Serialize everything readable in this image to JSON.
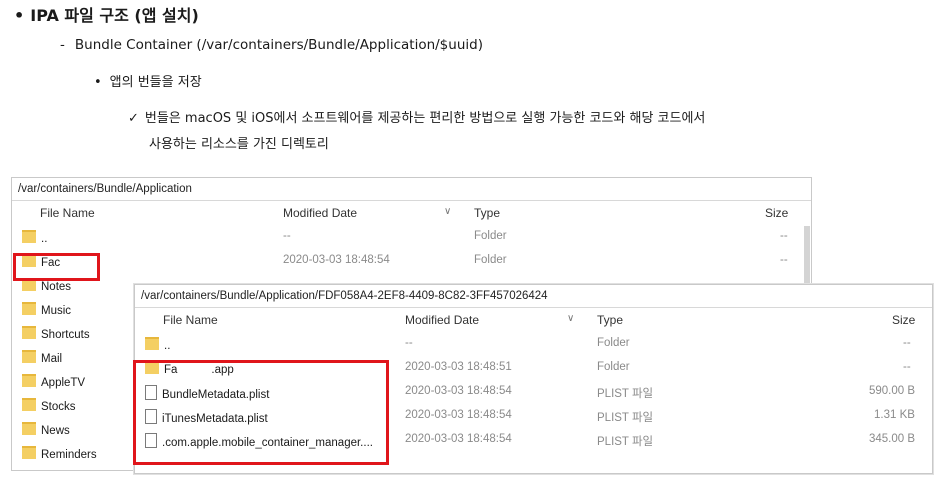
{
  "slide": {
    "heading_bullet": "•",
    "heading": "IPA 파일 구조 (앱 설치)",
    "sub_dash": "-",
    "sub": "Bundle Container (/var/containers/Bundle/Application/$uuid)",
    "item_bullet": "•",
    "item": "앱의 번들을 저장",
    "check": "✓",
    "detail_line1": "번들은 macOS 및 iOS에서 소프트웨어를 제공하는 편리한 방법으로 실행 가능한 코드와 해당 코드에서",
    "detail_line2": "사용하는 리소스를 가진 디렉토리"
  },
  "window1": {
    "path": "/var/containers/Bundle/Application",
    "headers": {
      "name": "File Name",
      "date": "Modified Date",
      "type": "Type",
      "size": "Size"
    },
    "rows": [
      {
        "name": "..",
        "date": "--",
        "type": "Folder",
        "size": "--"
      },
      {
        "name": "Fac",
        "date": "2020-03-03 18:48:54",
        "type": "Folder",
        "size": "--"
      },
      {
        "name": "Notes"
      },
      {
        "name": "Music"
      },
      {
        "name": "Shortcuts"
      },
      {
        "name": "Mail"
      },
      {
        "name": "AppleTV"
      },
      {
        "name": "Stocks"
      },
      {
        "name": "News"
      },
      {
        "name": "Reminders"
      }
    ]
  },
  "window2": {
    "path": "/var/containers/Bundle/Application/FDF058A4-2EF8-4409-8C82-3FF457026424",
    "headers": {
      "name": "File Name",
      "date": "Modified Date",
      "type": "Type",
      "size": "Size"
    },
    "rows": [
      {
        "name": "..",
        "date": "--",
        "type": "Folder",
        "size": "--"
      },
      {
        "name": "Fa",
        "name2": ".app",
        "date": "2020-03-03 18:48:51",
        "type": "Folder",
        "size": "--"
      },
      {
        "name": "BundleMetadata.plist",
        "date": "2020-03-03 18:48:54",
        "type": "PLIST 파일",
        "size": "590.00 B"
      },
      {
        "name": "iTunesMetadata.plist",
        "date": "2020-03-03 18:48:54",
        "type": "PLIST 파일",
        "size": "1.31 KB"
      },
      {
        "name": ".com.apple.mobile_container_manager....",
        "date": "2020-03-03 18:48:54",
        "type": "PLIST 파일",
        "size": "345.00 B"
      }
    ]
  },
  "icons": {
    "sort": "chevron-down-icon",
    "folder": "folder-icon",
    "file": "file-icon"
  },
  "colors": {
    "highlight": "#e0151b",
    "folder": "#f4cf63"
  }
}
